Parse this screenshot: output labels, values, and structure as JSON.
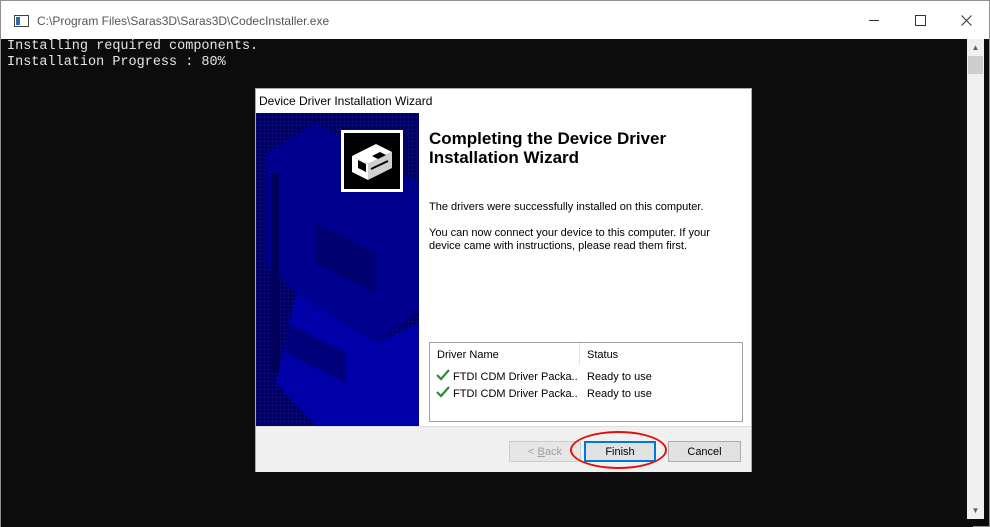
{
  "window": {
    "title": "C:\\Program Files\\Saras3D\\Saras3D\\CodecInstaller.exe",
    "icons": {
      "app": "console-app-icon",
      "minimize": "minimize-icon",
      "maximize": "maximize-icon",
      "close": "close-icon"
    }
  },
  "console": {
    "lines": [
      "Installing required components.",
      "Installation Progress : 80%"
    ]
  },
  "dialog": {
    "title": "Device Driver Installation Wizard",
    "heading": "Completing the Device Driver Installation Wizard",
    "text1": "The drivers were successfully installed on this computer.",
    "text2": "You can now connect your device to this computer. If your device came with instructions, please read them first.",
    "table": {
      "headers": [
        "Driver Name",
        "Status"
      ],
      "rows": [
        {
          "name": "FTDI CDM Driver Packa...",
          "status": "Ready to use",
          "icon": "checkmark-icon"
        },
        {
          "name": "FTDI CDM Driver Packa...",
          "status": "Ready to use",
          "icon": "checkmark-icon"
        }
      ]
    },
    "buttons": {
      "back_prefix": "< ",
      "back_mnemonic": "B",
      "back_rest": "ack",
      "finish": "Finish",
      "cancel": "Cancel"
    }
  },
  "colors": {
    "console_bg": "#0c0c0c",
    "console_text": "#e6e6e6",
    "banner_bg": "#000066",
    "check_green": "#2e8b2e",
    "annotation_red": "#e01010",
    "focus_blue": "#0078d7"
  }
}
